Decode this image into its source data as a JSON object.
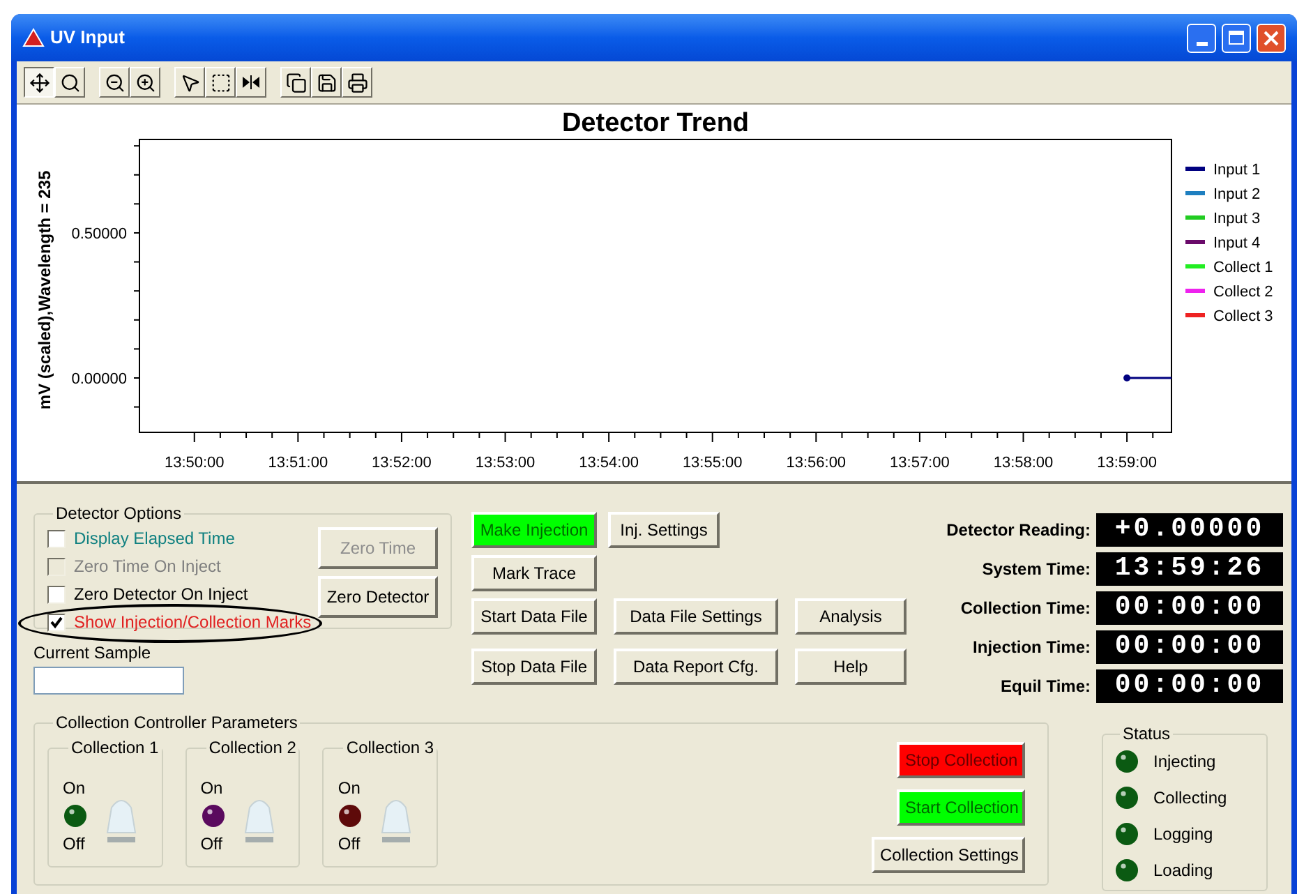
{
  "window": {
    "title": "UV Input"
  },
  "toolbar": [
    {
      "selected": true
    },
    {
      "selected": false
    },
    {
      "selected": false
    },
    {
      "selected": false
    },
    {
      "selected": false
    },
    {
      "selected": false
    },
    {
      "selected": false
    },
    {
      "selected": false
    },
    {
      "selected": false
    },
    {
      "selected": false
    }
  ],
  "chart": {
    "chart_data": {
      "type": "line",
      "title": "Detector Trend",
      "ylabel": "mV (scaled),Wavelength = 235",
      "categories": [
        "13:50:00",
        "13:51:00",
        "13:52:00",
        "13:53:00",
        "13:54:00",
        "13:55:00",
        "13:56:00",
        "13:57:00",
        "13:58:00",
        "13:59:00"
      ],
      "ylim": [
        -0.1875,
        0.822
      ],
      "yticks": [
        {
          "value": 0,
          "label": "0.00000"
        },
        {
          "value": 0.5,
          "label": "0.50000"
        }
      ],
      "series": [
        {
          "name": "Input 1",
          "color": "#000080",
          "marker": "dot",
          "values": [
            null,
            null,
            null,
            null,
            null,
            null,
            null,
            null,
            null,
            0
          ]
        },
        {
          "name": "Input 2",
          "color": "#1e7fc0",
          "values": [
            null,
            null,
            null,
            null,
            null,
            null,
            null,
            null,
            null,
            null
          ]
        },
        {
          "name": "Input 3",
          "color": "#22cc22",
          "values": [
            null,
            null,
            null,
            null,
            null,
            null,
            null,
            null,
            null,
            null
          ]
        },
        {
          "name": "Input 4",
          "color": "#6a0a6a",
          "values": [
            null,
            null,
            null,
            null,
            null,
            null,
            null,
            null,
            null,
            null
          ]
        },
        {
          "name": "Collect 1",
          "color": "#22ee22",
          "values": [
            null,
            null,
            null,
            null,
            null,
            null,
            null,
            null,
            null,
            null
          ]
        },
        {
          "name": "Collect 2",
          "color": "#ee22ee",
          "values": [
            null,
            null,
            null,
            null,
            null,
            null,
            null,
            null,
            null,
            null
          ]
        },
        {
          "name": "Collect 3",
          "color": "#ee2222",
          "values": [
            null,
            null,
            null,
            null,
            null,
            null,
            null,
            null,
            null,
            null
          ]
        }
      ]
    }
  },
  "detector_options": {
    "title": "Detector Options",
    "options": [
      {
        "label": "Display Elapsed Time",
        "checked": false,
        "disabled": false,
        "highlighted": false,
        "color": "#108080"
      },
      {
        "label": "Zero Time On Inject",
        "checked": false,
        "disabled": true,
        "highlighted": false,
        "color": "#808080"
      },
      {
        "label": "Zero Detector On Inject",
        "checked": false,
        "disabled": false,
        "highlighted": false,
        "color": "#000000"
      },
      {
        "label": "Show Injection/Collection Marks",
        "checked": true,
        "disabled": false,
        "highlighted": true,
        "color": "#e02020"
      }
    ],
    "buttons": [
      {
        "label": "Zero Time",
        "disabled": true
      },
      {
        "label": "Zero Detector",
        "disabled": false
      }
    ]
  },
  "current_sample": {
    "label": "Current Sample"
  },
  "actions": [
    [
      {
        "label": "Make Injection",
        "color": "#00ff00"
      },
      {
        "label": "Inj. Settings"
      }
    ],
    [
      {
        "label": "Mark Trace"
      }
    ],
    [
      {
        "label": "Start Data File"
      },
      {
        "label": "Data File Settings"
      },
      {
        "label": "Analysis"
      }
    ],
    [
      {
        "label": "Stop Data File"
      },
      {
        "label": "Data Report Cfg."
      },
      {
        "label": "Help"
      }
    ]
  ],
  "readings": [
    {
      "label": "Detector Reading:",
      "value": "+0.00000"
    },
    {
      "label": "System Time:",
      "value": "13:59:26"
    },
    {
      "label": "Collection Time:",
      "value": "00:00:00"
    },
    {
      "label": "Injection Time:",
      "value": "00:00:00"
    },
    {
      "label": "Equil Time:",
      "value": "00:00:00"
    }
  ],
  "collection_controller": {
    "title": "Collection Controller Parameters",
    "collections": [
      {
        "title": "Collection 1",
        "on_label": "On",
        "off_label": "Off",
        "color": "#0b5a12",
        "on": false,
        "switch_on": false
      },
      {
        "title": "Collection 2",
        "on_label": "On",
        "off_label": "Off",
        "color": "#5a0a5e",
        "on": false,
        "switch_on": false
      },
      {
        "title": "Collection 3",
        "on_label": "On",
        "off_label": "Off",
        "color": "#5e0a0a",
        "on": false,
        "switch_on": false
      }
    ],
    "buttons": [
      {
        "label": "Stop Collection",
        "color": "#ff0000"
      },
      {
        "label": "Start Collection",
        "color": "#00ff00"
      },
      {
        "label": "Collection Settings"
      }
    ]
  },
  "status": {
    "title": "Status",
    "items": [
      {
        "label": "Injecting",
        "on": false
      },
      {
        "label": "Collecting",
        "on": false
      },
      {
        "label": "Logging",
        "on": false
      },
      {
        "label": "Loading",
        "on": false
      }
    ]
  }
}
